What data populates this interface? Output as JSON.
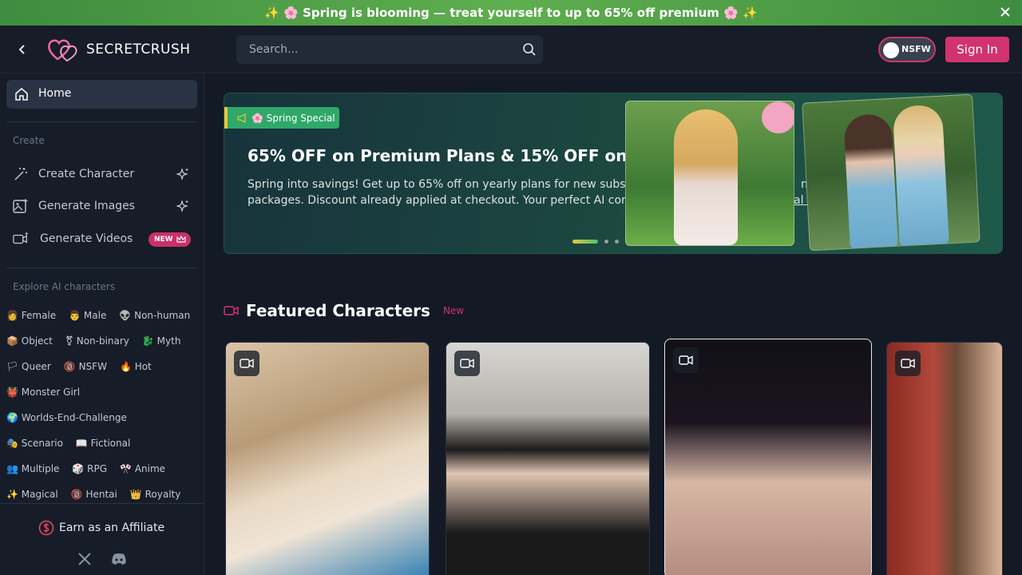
{
  "promo": {
    "text": "✨ 🌸 Spring is blooming — treat yourself to up to 65% off premium 🌸 ✨"
  },
  "header": {
    "logo_part1": "SECRET",
    "logo_part2": "CRUSH",
    "search_placeholder": "Search...",
    "nsfw_label": "NSFW",
    "signin_label": "Sign In"
  },
  "sidebar": {
    "home_label": "Home",
    "create_section": "Create",
    "create_items": [
      {
        "label": "Create Character"
      },
      {
        "label": "Generate Images"
      },
      {
        "label": "Generate Videos",
        "badge": "NEW"
      }
    ],
    "explore_section": "Explore AI characters",
    "tags": [
      [
        "👩 Female",
        "👨 Male",
        "👽 Non-human"
      ],
      [
        "📦 Object",
        "⚧ Non-binary",
        "🐉 Myth"
      ],
      [
        "🏳 Queer",
        "🔞 NSFW",
        "🔥 Hot"
      ],
      [
        "👹 Monster Girl"
      ],
      [
        "🌍 Worlds-End-Challenge"
      ],
      [
        "🎭 Scenario",
        "📖 Fictional"
      ],
      [
        "👥 Multiple",
        "🎲 RPG",
        "🎌 Anime"
      ],
      [
        "✨ Magical",
        "🔞 Hentai",
        "👑 Royalty"
      ]
    ],
    "affiliate_label": "Earn as an Affiliate"
  },
  "banner": {
    "tag": "🌸 Spring Special",
    "title": "65% OFF on Premium Plans & 15% OFF on",
    "desc_line1": "Spring into savings! Get up to 65% off on yearly plans for new subs",
    "desc_line1_end": "ns",
    "desc_line2": "packages. Discount already applied at checkout. Your perfect AI con",
    "desc_line2_end": "al t"
  },
  "featured": {
    "title": "Featured Characters",
    "badge": "New"
  },
  "colors": {
    "accent": "#d1336f",
    "promo_green": "#5fae4f",
    "sidebar_bg": "#161c28"
  }
}
